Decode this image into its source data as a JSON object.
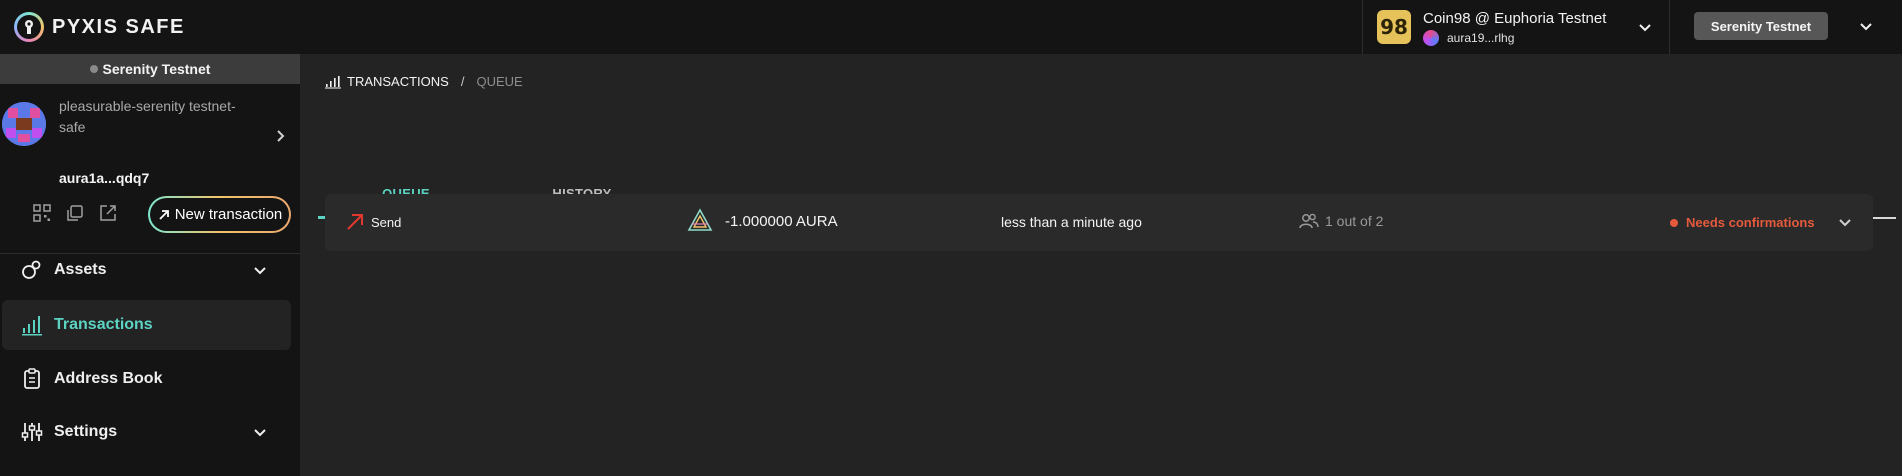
{
  "header": {
    "logo_text": "PYXIS SAFE",
    "wallet": {
      "logo_glyph": "98",
      "name": "Coin98 @ Euphoria Testnet",
      "address": "aura19...rlhg"
    },
    "network_button": "Serenity Testnet",
    "colors": {
      "accent": "#5cd3c2",
      "wallet_logo": "#e6c35a",
      "network_button": "#575757"
    }
  },
  "sidebar": {
    "network_label": "Serenity Testnet",
    "safe": {
      "name": "pleasurable-serenity testnet-safe",
      "address": "aura1a...qdq7"
    },
    "tools": {
      "qr": "qr-code-icon",
      "copy": "copy-icon",
      "open": "external-link-icon"
    },
    "new_transaction_label": "New transaction",
    "nav": [
      {
        "label": "Assets",
        "icon": "assets-icon",
        "expandable": true
      },
      {
        "label": "Transactions",
        "icon": "transactions-icon",
        "active": true
      },
      {
        "label": "Address Book",
        "icon": "address-book-icon"
      },
      {
        "label": "Settings",
        "icon": "settings-icon",
        "expandable": true
      }
    ]
  },
  "main": {
    "breadcrumb": {
      "section": "TRANSACTIONS",
      "separator": "/",
      "current": "QUEUE"
    },
    "tabs": [
      {
        "label": "QUEUE",
        "active": true
      },
      {
        "label": "HISTORY",
        "active": false
      }
    ],
    "transactions": [
      {
        "type": "Send",
        "amount": "-1.000000 AURA",
        "time": "less than a minute ago",
        "signers": "1 out of 2",
        "status": "Needs confirmations",
        "status_color": "#e55a3c"
      }
    ]
  }
}
